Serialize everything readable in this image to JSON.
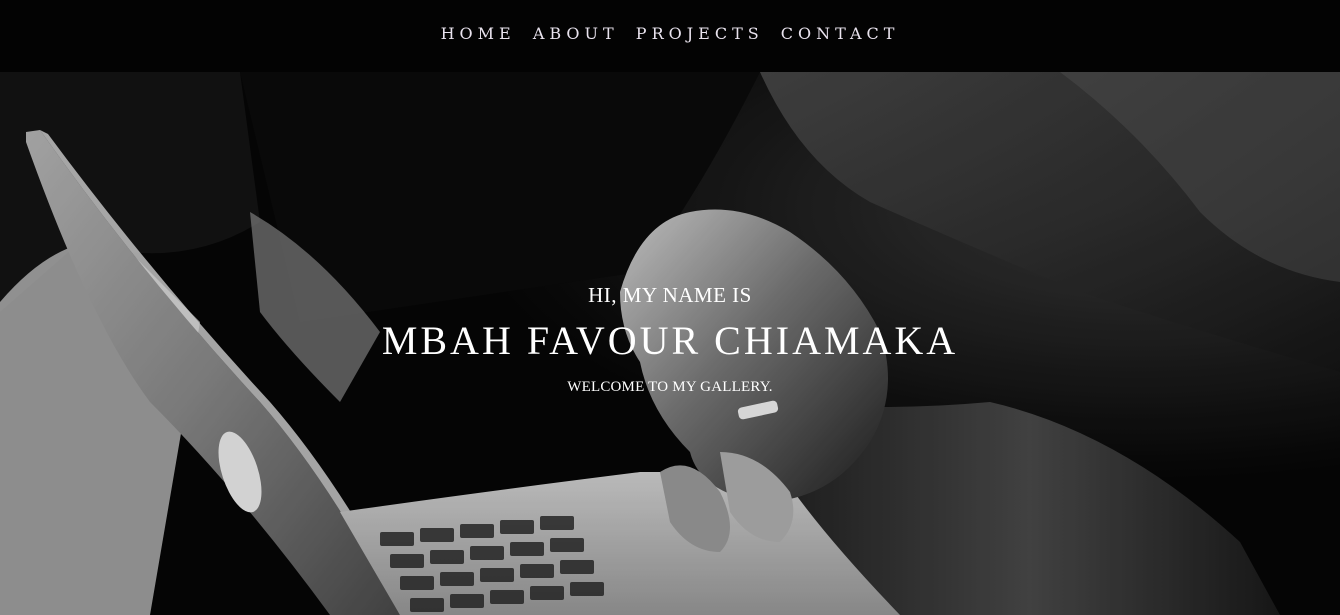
{
  "nav": {
    "items": [
      {
        "label": "HOME"
      },
      {
        "label": "ABOUT"
      },
      {
        "label": "PROJECTS"
      },
      {
        "label": "CONTACT"
      }
    ]
  },
  "hero": {
    "greeting": "HI, MY NAME IS",
    "name": "MBAH FAVOUR CHIAMAKA",
    "tagline": "WELCOME TO MY GALLERY.",
    "background_image": "black-and-white photo of hands typing on a laptop"
  },
  "colors": {
    "navbar_bg": "#030303",
    "nav_text": "#e9e3ee",
    "hero_text": "#ffffff"
  }
}
